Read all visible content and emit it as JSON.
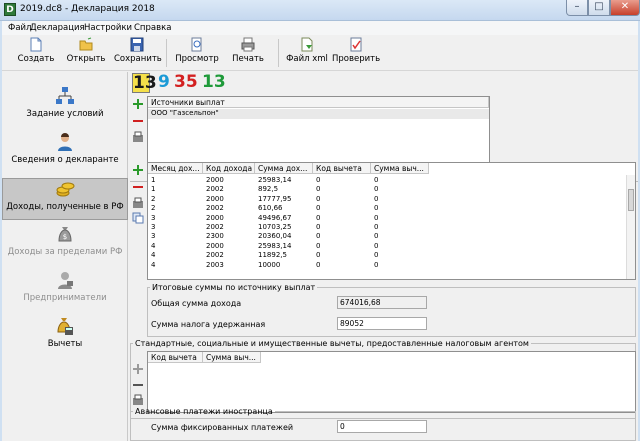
{
  "window": {
    "title": "2019.dc8 - Декларация 2018",
    "app_icon_letter": "D"
  },
  "menu": [
    "Файл",
    "Декларация",
    "Настройки",
    "Справка"
  ],
  "toolbar": [
    {
      "label": "Создать",
      "icon": "new-document-icon"
    },
    {
      "label": "Открыть",
      "icon": "open-folder-icon"
    },
    {
      "label": "Сохранить",
      "icon": "save-disk-icon"
    },
    {
      "label": "Просмотр",
      "icon": "preview-icon"
    },
    {
      "label": "Печать",
      "icon": "printer-icon"
    },
    {
      "label": "Файл xml",
      "icon": "xml-file-icon"
    },
    {
      "label": "Проверить",
      "icon": "check-icon"
    }
  ],
  "sidebar": [
    {
      "label": "Задание условий",
      "icon": "conditions-tree-icon",
      "state": "normal"
    },
    {
      "label": "Сведения о декларанте",
      "icon": "person-icon",
      "state": "normal"
    },
    {
      "label": "Доходы, полученные в РФ",
      "icon": "coins-icon",
      "state": "active"
    },
    {
      "label": "Доходы за пределами РФ",
      "icon": "money-bag-icon",
      "state": "disabled"
    },
    {
      "label": "Предприниматели",
      "icon": "entrepreneur-icon",
      "state": "disabled"
    },
    {
      "label": "Вычеты",
      "icon": "deductions-icon",
      "state": "normal"
    }
  ],
  "rate_tabs": [
    {
      "label": "13",
      "color": "#1a1a1a",
      "selected": true
    },
    {
      "label": "9",
      "color": "#1b9ad6"
    },
    {
      "label": "35",
      "color": "#d32020"
    },
    {
      "label": "13",
      "color": "#1f9a3a"
    }
  ],
  "sources": {
    "header": "Источники выплат",
    "items": [
      "ООО \"Газсельпон\""
    ]
  },
  "income_table": {
    "columns": [
      "Месяц дох...",
      "Код дохода",
      "Сумма дох...",
      "Код вычета",
      "Сумма выч..."
    ],
    "rows": [
      [
        "1",
        "2000",
        "25983,14",
        "0",
        "0"
      ],
      [
        "1",
        "2002",
        "892,5",
        "0",
        "0"
      ],
      [
        "2",
        "2000",
        "17777,95",
        "0",
        "0"
      ],
      [
        "2",
        "2002",
        "610,66",
        "0",
        "0"
      ],
      [
        "3",
        "2000",
        "49496,67",
        "0",
        "0"
      ],
      [
        "3",
        "2002",
        "10703,25",
        "0",
        "0"
      ],
      [
        "3",
        "2300",
        "20360,04",
        "0",
        "0"
      ],
      [
        "4",
        "2000",
        "25983,14",
        "0",
        "0"
      ],
      [
        "4",
        "2002",
        "11892,5",
        "0",
        "0"
      ],
      [
        "4",
        "2003",
        "10000",
        "0",
        "0"
      ]
    ]
  },
  "totals": {
    "legend": "Итоговые суммы по источнику выплат",
    "total_income_label": "Общая сумма дохода",
    "total_income_value": "674016,68",
    "tax_withheld_label": "Сумма налога удержанная",
    "tax_withheld_value": "89052"
  },
  "deductions": {
    "legend": "Стандартные, социальные и имущественные вычеты, предоставленные налоговым агентом",
    "columns": [
      "Код вычета",
      "Сумма выч..."
    ]
  },
  "advance": {
    "legend": "Авансовые платежи иностранца",
    "fixed_payments_label": "Сумма фиксированных платежей",
    "fixed_payments_value": "0"
  }
}
